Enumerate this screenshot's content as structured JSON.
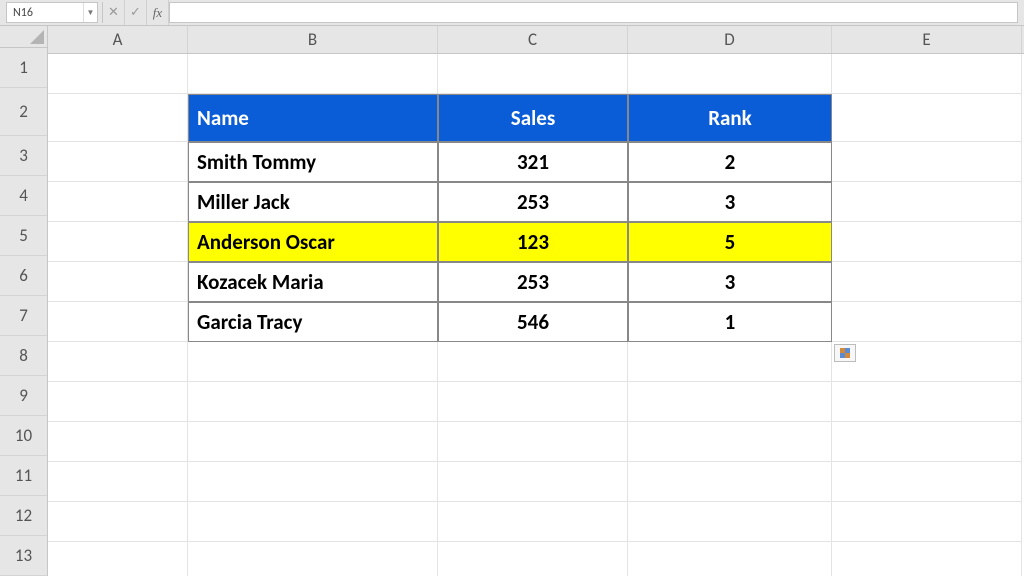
{
  "formula_bar": {
    "cell_ref": "N16",
    "formula": ""
  },
  "columns": [
    "A",
    "B",
    "C",
    "D",
    "E"
  ],
  "row_numbers": [
    "1",
    "2",
    "3",
    "4",
    "5",
    "6",
    "7",
    "8",
    "9",
    "10",
    "11",
    "12",
    "13"
  ],
  "table": {
    "headers": {
      "name": "Name",
      "sales": "Sales",
      "rank": "Rank"
    },
    "rows": [
      {
        "name": "Smith Tommy",
        "sales": "321",
        "rank": "2",
        "highlight": false
      },
      {
        "name": "Miller Jack",
        "sales": "253",
        "rank": "3",
        "highlight": false
      },
      {
        "name": "Anderson Oscar",
        "sales": "123",
        "rank": "5",
        "highlight": true
      },
      {
        "name": "Kozacek Maria",
        "sales": "253",
        "rank": "3",
        "highlight": false
      },
      {
        "name": "Garcia Tracy",
        "sales": "546",
        "rank": "1",
        "highlight": false
      }
    ]
  }
}
